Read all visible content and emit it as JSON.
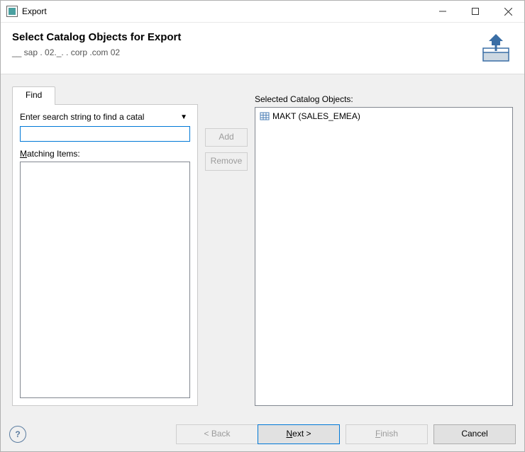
{
  "window": {
    "title": "Export"
  },
  "header": {
    "title": "Select Catalog Objects for Export",
    "subtitle": "__  sap .   02._. .  corp        .com 02"
  },
  "find": {
    "tab_label": "Find",
    "filter_text": "Enter search string to find a catal",
    "search_value": "",
    "matching_label_pre": "M",
    "matching_label_rest": "atching Items:"
  },
  "buttons": {
    "add": "Add",
    "remove": "Remove"
  },
  "selected": {
    "label": "Selected Catalog Objects:",
    "items": [
      {
        "label": "MAKT (SALES_EMEA)"
      }
    ]
  },
  "wizard": {
    "back": "< Back",
    "next_pre": "N",
    "next_rest": "ext >",
    "finish_pre": "F",
    "finish_rest": "inish",
    "cancel": "Cancel"
  }
}
